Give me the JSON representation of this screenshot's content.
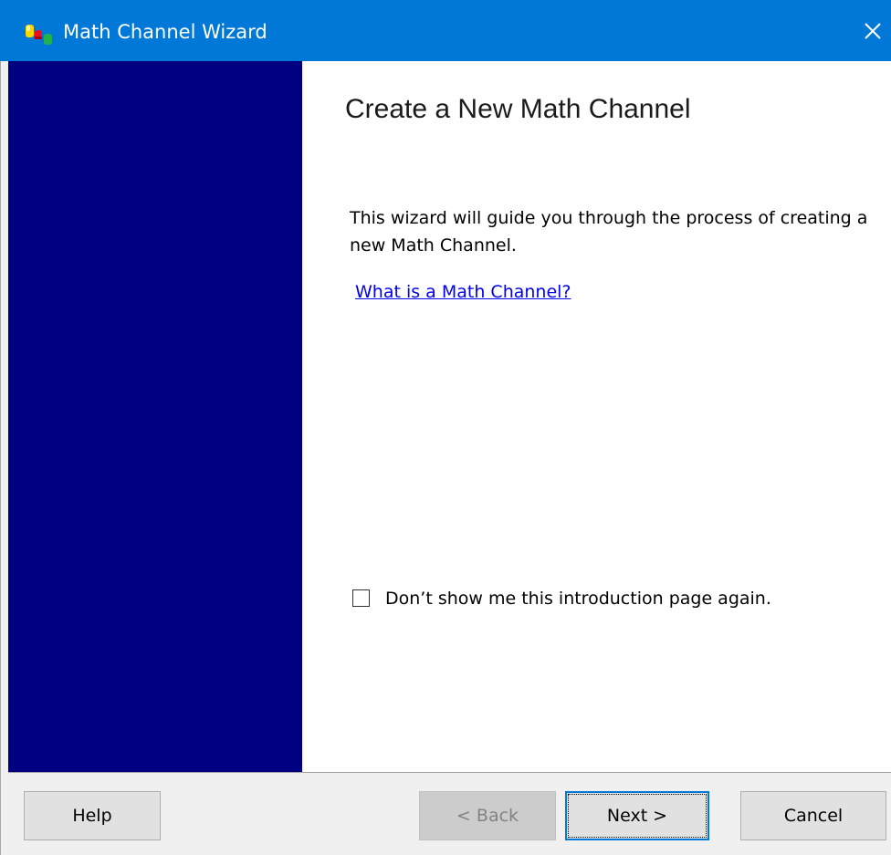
{
  "window": {
    "title": "Math Channel Wizard"
  },
  "content": {
    "heading": "Create a New Math Channel",
    "intro": "This wizard will guide you through the process of creating a new Math Channel.",
    "help_link": "What is a Math Channel?",
    "dont_show_label": "Don’t show me this introduction page again.",
    "dont_show_checked": false
  },
  "buttons": {
    "help": "Help",
    "back": "< Back",
    "next": "Next >",
    "cancel": "Cancel"
  },
  "colors": {
    "titlebar": "#0078d7",
    "side_panel": "#000080",
    "link": "#0000ee"
  },
  "icons": {
    "app": "math-channel-icon",
    "close": "close-icon"
  }
}
